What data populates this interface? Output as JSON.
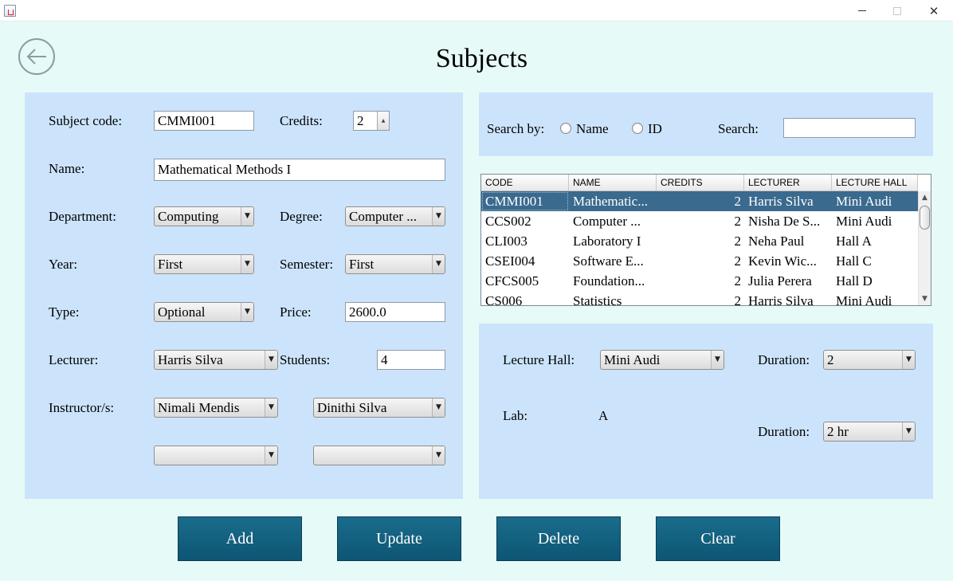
{
  "window": {
    "minimize_icon": "minimize-icon",
    "maximize_icon": "maximize-icon",
    "close_glyph": "✕"
  },
  "page": {
    "title": "Subjects",
    "back_icon": "arrow-left-icon"
  },
  "form": {
    "subject_code_label": "Subject code:",
    "subject_code_value": "CMMI001",
    "credits_label": "Credits:",
    "credits_value": "2",
    "name_label": "Name:",
    "name_value": "Mathematical Methods I",
    "department_label": "Department:",
    "department_value": "Computing",
    "degree_label": "Degree:",
    "degree_value": "Computer ...",
    "year_label": "Year:",
    "year_value": "First",
    "semester_label": "Semester:",
    "semester_value": "First",
    "type_label": "Type:",
    "type_value": "Optional",
    "price_label": "Price:",
    "price_value": "2600.0",
    "lecturer_label": "Lecturer:",
    "lecturer_value": "Harris Silva",
    "students_label": "Students:",
    "students_value": "4",
    "instructors_label": "Instructor/s:",
    "instructor1_value": "Nimali Mendis",
    "instructor2_value": "Dinithi Silva",
    "instructor3_value": "",
    "instructor4_value": ""
  },
  "search": {
    "search_by_label": "Search by:",
    "option_name": "Name",
    "option_id": "ID",
    "search_label": "Search:",
    "search_value": ""
  },
  "table": {
    "columns": [
      "CODE",
      "NAME",
      "CREDITS",
      "LECTURER",
      "LECTURE HALL"
    ],
    "rows": [
      [
        "CMMI001",
        "Mathematic...",
        "2",
        "Harris Silva",
        "Mini Audi"
      ],
      [
        "CCS002",
        "Computer ...",
        "2",
        "Nisha De S...",
        "Mini Audi"
      ],
      [
        "CLI003",
        "Laboratory I",
        "2",
        "Neha Paul",
        "Hall A"
      ],
      [
        "CSEI004",
        "Software E...",
        "2",
        "Kevin Wic...",
        "Hall C"
      ],
      [
        "CFCS005",
        "Foundation...",
        "2",
        "Julia Perera",
        "Hall D"
      ],
      [
        "CS006",
        "Statistics",
        "2",
        "Harris Silva",
        "Mini Audi"
      ]
    ]
  },
  "schedule": {
    "lecture_hall_label": "Lecture Hall:",
    "lecture_hall_value": "Mini Audi",
    "duration_label": "Duration:",
    "lecture_duration_value": "2",
    "lab_label": "Lab:",
    "lab_value": "A",
    "lab_duration_label": "Duration:",
    "lab_duration_value": "2 hr"
  },
  "actions": {
    "add": "Add",
    "update": "Update",
    "delete": "Delete",
    "clear": "Clear"
  }
}
